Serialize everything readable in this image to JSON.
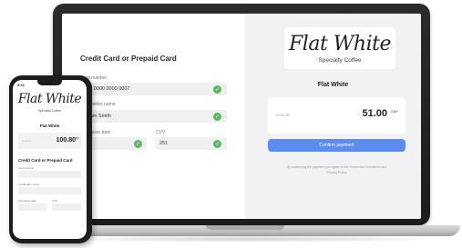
{
  "laptop": {
    "form": {
      "title": "Credit Card or Prepaid Card",
      "card_number_label": "Card number",
      "card_number_value": "000 0000 0000 0007",
      "holder_label": "Cardholder name",
      "holder_value": "Adam Smith",
      "expiry_label": "Expiration date",
      "expiry_value": "/24",
      "cvv_label": "CVV",
      "cvv_value": "251",
      "check_glyph": "✓"
    },
    "merchant": {
      "logo": "Flat White",
      "subtitle": "Specialty Coffee",
      "name": "Flat White",
      "amount_label": "Amount",
      "amount": "51.00",
      "currency": "GBP",
      "confirm_label": "Confirm payment",
      "terms": "By confirming the payment you agree to the Terms and Conditions and Privacy Policy"
    }
  },
  "phone": {
    "time": "9:41",
    "logo": "Flat White",
    "subtitle": "Specialty Coffee",
    "merchant_name": "Flat White",
    "amount_label": "Amount",
    "amount": "100.80",
    "currency": "GBP",
    "form_title": "Credit Card or Prepaid Card",
    "card_number_label": "Card number",
    "holder_label": "Cardholder name",
    "expiry_label": "Expiration date",
    "cvv_label": "CVV"
  },
  "colors": {
    "accent": "#5b8def",
    "success": "#5cb85c",
    "panel_bg": "#f2f2f4"
  }
}
